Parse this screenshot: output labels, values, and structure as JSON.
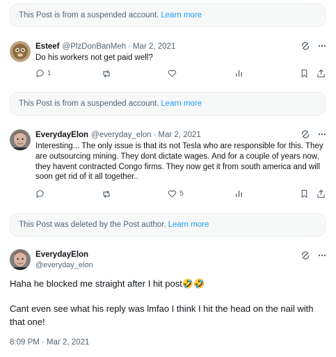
{
  "notices": [
    {
      "text": "This Post is from a suspended account.",
      "link": "Learn more"
    },
    {
      "text": "This Post is from a suspended account.",
      "link": "Learn more"
    },
    {
      "text": "This Post was deleted by the Post author.",
      "link": "Learn more"
    }
  ],
  "reply1": {
    "name": "Esteef",
    "handle": "@PlzDonBanMeh",
    "separator": "·",
    "date": "Mar 2, 2021",
    "text": "Do his workers not get paid well?",
    "reply_count": "1"
  },
  "reply2": {
    "name": "EverydayElon",
    "handle": "@everyday_elon",
    "separator": "·",
    "date": "Mar 2, 2021",
    "text": "Interesting... The only issue is that its not Tesla who are responsible for this. They are outsourcing mining. They dont dictate wages. And for a couple of years now, they havent contracted Congo firms. They now get it from south america and will soon get rid of it all together..",
    "like_count": "5"
  },
  "main": {
    "name": "EverydayElon",
    "handle": "@everyday_elon",
    "line1": "Haha he blocked me straight after I hit post",
    "emoji": "🤣🤣",
    "line2": "Cant even see what his reply was lmfao I think I hit the head on the nail with that one!",
    "timestamp": "8:09 PM · Mar 2, 2021"
  },
  "icons": {
    "grok": "grok-icon",
    "more": "more-icon",
    "reply": "reply-icon",
    "repost": "repost-icon",
    "like": "like-icon",
    "views": "views-icon",
    "bookmark": "bookmark-icon",
    "share": "share-icon"
  },
  "colors": {
    "link": "#1d9bf0",
    "secondary": "#536471",
    "notice_bg": "#f7f9f9"
  }
}
